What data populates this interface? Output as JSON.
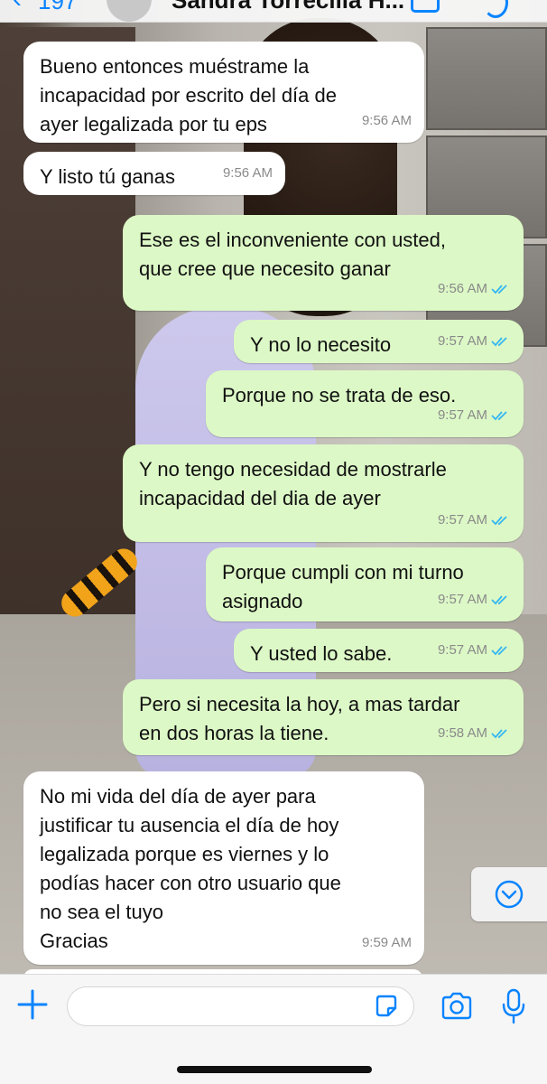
{
  "header": {
    "back_count": "197",
    "contact_name": "Sandra Torrecilla H..."
  },
  "messages": [
    {
      "text": "Bueno entonces muéstrame la\nincapacidad por escrito del día de\nayer legalizada por tu eps",
      "time": "9:56 AM",
      "direction": "in"
    },
    {
      "text": "Y listo tú ganas",
      "time": "9:56 AM",
      "direction": "in"
    },
    {
      "text": "Ese es el inconveniente con usted,\nque cree que necesito ganar",
      "time": "9:56 AM",
      "direction": "out"
    },
    {
      "text": "Y no lo necesito",
      "time": "9:57 AM",
      "direction": "out"
    },
    {
      "text": "Porque no se trata de eso.",
      "time": "9:57 AM",
      "direction": "out"
    },
    {
      "text": "Y no tengo necesidad de mostrarle\nincapacidad del dia de ayer",
      "time": "9:57 AM",
      "direction": "out"
    },
    {
      "text": "Porque cumpli con mi turno\nasignado",
      "time": "9:57 AM",
      "direction": "out"
    },
    {
      "text": "Y usted lo sabe.",
      "time": "9:57 AM",
      "direction": "out"
    },
    {
      "text": "Pero si necesita la hoy, a mas tardar\nen dos horas la tiene.",
      "time": "9:58 AM",
      "direction": "out"
    },
    {
      "text": "No mi vida del día de ayer para\njustificar tu ausencia el día de hoy\nlegalizada porque es viernes y lo\npodías hacer con otro usuario que\nno sea el tuyo\nGracias",
      "time": "9:59 AM",
      "direction": "in"
    }
  ],
  "colors": {
    "incoming_bubble": "#ffffff",
    "outgoing_bubble": "#dcf8c6",
    "accent": "#0a84ff",
    "read_ticks": "#34b7f1"
  },
  "icons": [
    "chevron-left-icon",
    "video-call-icon",
    "phone-icon",
    "read-ticks-icon",
    "chevron-down-icon",
    "plus-icon",
    "sticker-icon",
    "camera-icon",
    "microphone-icon"
  ]
}
